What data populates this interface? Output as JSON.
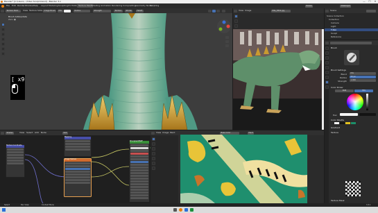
{
  "window": {
    "title": "Blender* [C:\\Users\\...\\T-Rex Sculpt.blend] - Blender 3.x",
    "controls": [
      "—",
      "☐",
      "✕"
    ]
  },
  "topbar": {
    "menus": [
      "File",
      "Edit",
      "Render",
      "Window",
      "Help"
    ],
    "workspaces": [
      "Layout",
      "Modeling",
      "Sculpting",
      "UV Editing",
      "Texture Paint",
      "Shading",
      "Animation",
      "Rendering",
      "Compositing",
      "Geometry Nodes",
      "Scripting"
    ],
    "active_workspace": "Texture Paint",
    "scene_label": "Scene",
    "view_layer_label": "ViewLayer"
  },
  "viewport_main": {
    "mode_label": "Texture Paint",
    "menus": [
      "View",
      "Texture Slots",
      "Brush",
      "Options"
    ],
    "header_buttons": [
      "Image Brush",
      "Mix",
      "Color",
      "Radius",
      "Strength",
      "Texture",
      "Stroke",
      "Falloff"
    ],
    "overlay_title": "Brush Add/update",
    "overlay_sub": "Zwiv ●",
    "key_hint": "[  x9",
    "axis_colors": {
      "x": "#e8463c",
      "y": "#7ab41f",
      "z": "#3a6fd8"
    }
  },
  "viewport_ref": {
    "menus": [
      "View",
      "Image",
      "Align"
    ],
    "image_label": "IMG_3841.jpg"
  },
  "outliner": {
    "title": "Scene",
    "items": [
      "Scene Collection",
      "Collection",
      "Camera",
      "Light",
      "T-Rex",
      "Sculpt",
      "Reference"
    ]
  },
  "properties": {
    "panel_brush": "Brush",
    "panel_texture": "Texture",
    "section_brush_settings": "Brush Settings",
    "rows": [
      {
        "label": "Blend",
        "value": "Mix"
      },
      {
        "label": "Radius",
        "value": "50 px"
      },
      {
        "label": "Strength",
        "value": "1.000"
      }
    ],
    "section_color": "Color Picker",
    "color_tabs": [
      "RGB",
      "HSV"
    ],
    "color_value_label": "Hex",
    "color_palette_label": "Color Palette",
    "gradient_label": "Gradient",
    "section_texture": "Texture",
    "section_mask": "Texture Mask",
    "swatches": [
      "#f5f5f5",
      "#141414",
      "#e0c020",
      "#1c8f6a"
    ]
  },
  "node_editor": {
    "menus": [
      "View",
      "Select",
      "Add",
      "Node"
    ],
    "slot_label": "Slot",
    "tree_label": "Shader",
    "nodes": [
      {
        "title": "Image Texture"
      },
      {
        "title": "Principled BSDF"
      },
      {
        "title": "Mapping"
      },
      {
        "title": "Material Output"
      },
      {
        "title": "Texture Coordinate"
      }
    ],
    "header_colors": {
      "texture": "#cf6a2e",
      "shader": "#3a8f3a",
      "vector": "#474ea8",
      "output": "#a13838"
    }
  },
  "image_editor": {
    "menus": [
      "View",
      "Image",
      "Paint"
    ],
    "image_name": "Base Color",
    "mode_label": "Paint"
  },
  "statusbar": {
    "left": "Select",
    "middle": "Pan View",
    "right": "Context Menu",
    "version": "3.3.1"
  }
}
